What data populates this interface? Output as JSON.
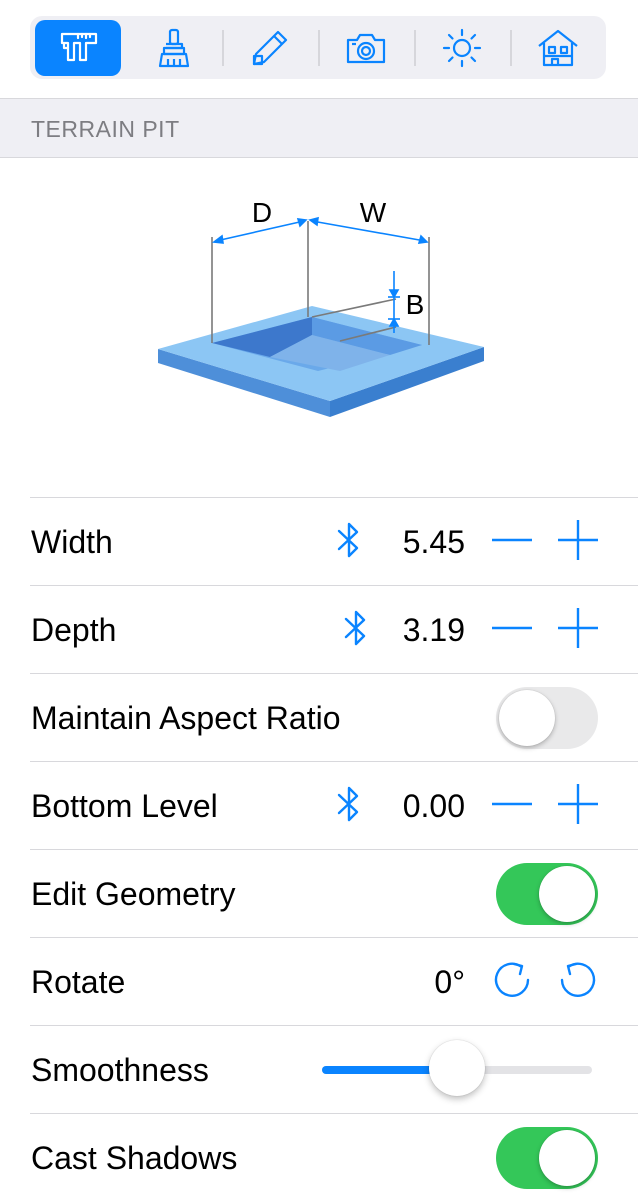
{
  "toolbar": {
    "tools": [
      {
        "name": "measure-caliper",
        "active": true
      },
      {
        "name": "brush",
        "active": false
      },
      {
        "name": "pencil-edit",
        "active": false
      },
      {
        "name": "camera",
        "active": false
      },
      {
        "name": "sun",
        "active": false
      },
      {
        "name": "house",
        "active": false
      }
    ]
  },
  "section": {
    "title": "TERRAIN PIT"
  },
  "diagram": {
    "label_d": "D",
    "label_w": "W",
    "label_b": "B"
  },
  "rows": {
    "width": {
      "label": "Width",
      "value": "5.45"
    },
    "depth": {
      "label": "Depth",
      "value": "3.19"
    },
    "aspect": {
      "label": "Maintain Aspect Ratio",
      "on": false
    },
    "bottom": {
      "label": "Bottom Level",
      "value": "0.00"
    },
    "edit_geometry": {
      "label": "Edit Geometry",
      "on": true
    },
    "rotate": {
      "label": "Rotate",
      "value": "0°"
    },
    "smoothness": {
      "label": "Smoothness",
      "level": 0.5
    },
    "cast_shadows": {
      "label": "Cast Shadows",
      "on": true
    }
  },
  "colors": {
    "accent": "#0a84ff",
    "toggle_on": "#34c759",
    "pit_blue": "#6aaef0"
  }
}
